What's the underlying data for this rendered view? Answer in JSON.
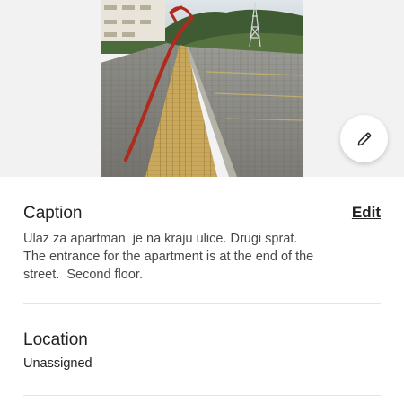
{
  "photo": {
    "icon": "listing-photo"
  },
  "edit_fab": {
    "icon": "pencil-icon"
  },
  "caption": {
    "title": "Caption",
    "edit_label": "Edit",
    "lines": [
      "Ulaz za apartman  je na kraju ulice. Drugi sprat.",
      "The entrance for the apartment is at the end of the",
      "street.  Second floor."
    ]
  },
  "location": {
    "title": "Location",
    "value": "Unassigned"
  },
  "colors": {
    "text_primary": "#222222",
    "text_secondary": "#484848",
    "divider": "#e4e4e4",
    "photo_background": "#f2f2f2"
  }
}
